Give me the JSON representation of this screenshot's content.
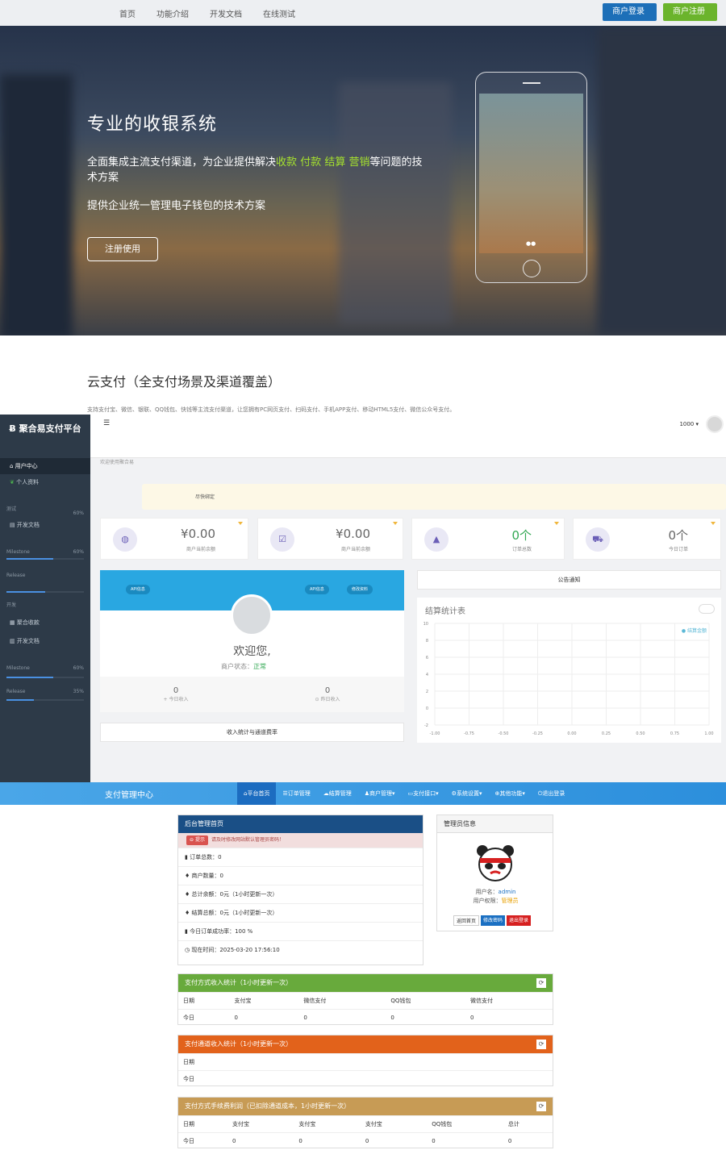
{
  "landing": {
    "nav": [
      "首页",
      "功能介绍",
      "开发文档",
      "在线测试"
    ],
    "login_button": "商户登录",
    "register_button": "商户注册",
    "hero_title": "专业的收银系统",
    "hero_line1_prefix": "全面集成主流支付渠道，为企业提供解决",
    "hero_highlights": [
      "收款",
      "付款",
      "结算",
      "营销"
    ],
    "hero_line1_suffix": "等问题的技术方案",
    "hero_line2": "提供企业统一管理电子钱包的技术方案",
    "hero_button": "注册使用",
    "cloud_title": "云支付（全支付场景及渠道覆盖）",
    "cloud_desc": "支持支付宝、微信、银联、QQ钱包、快钱等主流支付渠道，让您拥有PC网页支付、扫码支付、手机APP支付、移动HTML5支付、微信公众号支付。"
  },
  "dashboard": {
    "logo": "聚合易支付平台",
    "sidebar": {
      "items": [
        "用户中心",
        "个人资料",
        "开发文档",
        "聚合收款",
        "开发文档"
      ],
      "sections": [
        "测试",
        "开发"
      ],
      "progress": [
        {
          "label": "Milestone",
          "percent": "60%",
          "value": 0.6
        },
        {
          "label": "Release",
          "percent": "",
          "value": 0.5
        },
        {
          "label": "Milestone",
          "percent": "60%",
          "value": 0.6
        },
        {
          "label": "Release",
          "percent": "35%",
          "value": 0.35
        }
      ],
      "pct_top": "60%"
    },
    "header": {
      "user": "1000 ▾"
    },
    "breadcrumb": "欢迎使用聚合易",
    "notice": "尽快绑定",
    "stats": [
      {
        "value": "¥0.00",
        "label": "商户当前余额",
        "icon": "wallet-icon"
      },
      {
        "value": "¥0.00",
        "label": "商户当前余额",
        "icon": "check-icon"
      },
      {
        "value": "0个",
        "label": "订单总数",
        "icon": "chart-icon"
      },
      {
        "value": "0个",
        "label": "今日订单",
        "icon": "cart-icon"
      }
    ],
    "profile": {
      "tag_left": "API信息",
      "tag_right1": "API信息",
      "tag_right2": "修改资料",
      "welcome": "欢迎您,",
      "status_label": "商户状态：",
      "status_value": "正常"
    },
    "summary": [
      {
        "value": "0",
        "label": "今日收入"
      },
      {
        "value": "0",
        "label": "昨日收入"
      }
    ],
    "income_button": "收入统计与通道费率",
    "notice_panel": "公告通知",
    "chart": {
      "title": "结算统计表",
      "legend": "结算金额"
    }
  },
  "chart_data": {
    "type": "line",
    "title": "结算统计表",
    "x": [
      -1.0,
      -0.75,
      -0.5,
      -0.25,
      0.0,
      0.25,
      0.5,
      0.75,
      1.0
    ],
    "x_ticks": [
      "-1.00",
      "-0.75",
      "-0.50",
      "-0.25",
      "0.00",
      "0.25",
      "0.50",
      "0.75",
      "1.00"
    ],
    "y_ticks": [
      "10",
      "8",
      "6",
      "4",
      "2",
      "0",
      "-2"
    ],
    "ylim": [
      -2,
      10
    ],
    "xlim": [
      -1,
      1
    ],
    "series": [
      {
        "name": "结算金额",
        "values": []
      }
    ],
    "legend_position": "top-right",
    "grid": true
  },
  "admin": {
    "brand": "支付管理中心",
    "nav": [
      "平台首页",
      "订单管理",
      "结算管理",
      "商户管理▾",
      "支付接口▾",
      "系统设置▾",
      "其他功能▾",
      "退出登录"
    ],
    "home": {
      "title": "后台管理首页",
      "alert_tag": "提示",
      "alert_text": "请及时修改网站默认管理员密码！",
      "items": [
        "订单总数：0",
        "商户数量：0",
        "总计余额：0元（1小时更新一次）",
        "结算总额：0元（1小时更新一次）",
        "今日订单成功率：100 %",
        "现在时间：2025-03-20 17:56:10"
      ]
    },
    "manager": {
      "title": "管理员信息",
      "username_label": "用户名：",
      "username": "admin",
      "role_label": "用户权限：",
      "role": "管理员",
      "buttons": [
        "返回首页",
        "修改密码",
        "退出登录"
      ]
    },
    "pay_stats": {
      "title": "支付方式收入统计（1小时更新一次）",
      "headers": [
        "日期",
        "支付宝",
        "微信支付",
        "QQ钱包",
        "微信支付"
      ],
      "rows": [
        [
          "今日",
          "0",
          "0",
          "0",
          "0"
        ]
      ]
    },
    "channel_stats": {
      "title": "支付通道收入统计（1小时更新一次）",
      "headers": [
        "日期"
      ],
      "rows": [
        [
          "今日"
        ]
      ]
    },
    "fee_stats": {
      "title": "支付方式手续费利润（已扣除通道成本，1小时更新一次）",
      "headers": [
        "日期",
        "支付宝",
        "支付宝",
        "支付宝",
        "QQ钱包",
        "总计"
      ],
      "rows": [
        [
          "今日",
          "0",
          "0",
          "0",
          "0",
          "0"
        ]
      ]
    }
  }
}
